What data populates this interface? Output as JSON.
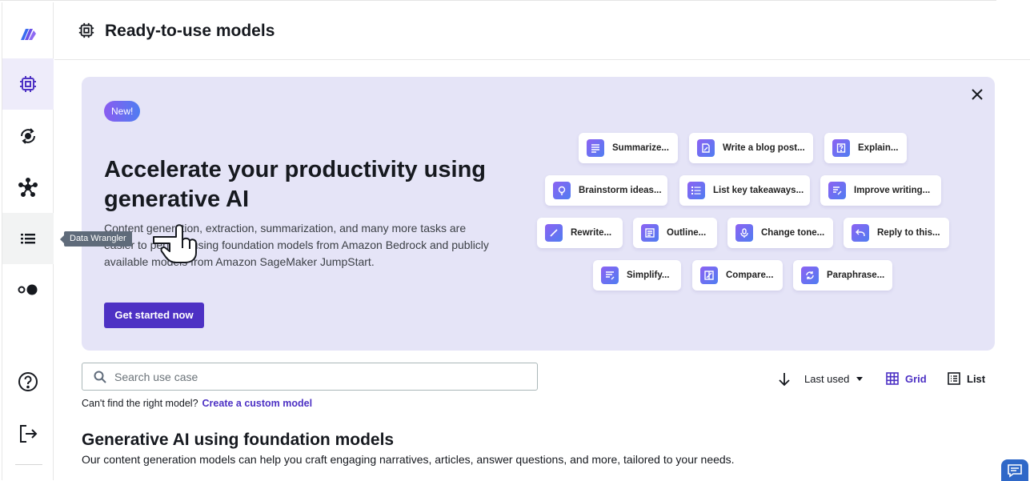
{
  "header": {
    "title": "Ready-to-use models"
  },
  "sidebar": {
    "tooltip": "Data Wrangler",
    "items": [
      {
        "name": "logo",
        "icon": "canvas-logo-icon"
      },
      {
        "name": "ready-to-use-models",
        "icon": "chip-icon",
        "active": true
      },
      {
        "name": "my-models",
        "icon": "model-cycle-icon"
      },
      {
        "name": "ml-ops",
        "icon": "network-nodes-icon"
      },
      {
        "name": "data-wrangler",
        "icon": "list-icon",
        "hovered": true
      },
      {
        "name": "toggle",
        "icon": "toggle-icon"
      },
      {
        "name": "help",
        "icon": "help-icon"
      },
      {
        "name": "sign-out",
        "icon": "sign-out-icon"
      }
    ]
  },
  "banner": {
    "badge": "New!",
    "title": "Accelerate your productivity using generative AI",
    "description": "Content generation, extraction, summarization, and many more tasks are easier to perform using foundation models from Amazon Bedrock and publicly available models from Amazon SageMaker JumpStart.",
    "cta": "Get started now",
    "chips": [
      {
        "label": "Summarize...",
        "icon": "lines-icon"
      },
      {
        "label": "Write a blog post...",
        "icon": "doc-edit-icon"
      },
      {
        "label": "Explain...",
        "icon": "question-doc-icon"
      },
      {
        "label": "Brainstorm ideas...",
        "icon": "lightbulb-icon"
      },
      {
        "label": "List key takeaways...",
        "icon": "bullet-list-icon"
      },
      {
        "label": "Improve writing...",
        "icon": "pen-lines-icon"
      },
      {
        "label": "Rewrite...",
        "icon": "pencil-icon"
      },
      {
        "label": "Outline...",
        "icon": "outline-icon"
      },
      {
        "label": "Change tone...",
        "icon": "microphone-icon"
      },
      {
        "label": "Reply to this...",
        "icon": "reply-icon"
      },
      {
        "label": "Simplify...",
        "icon": "simplify-icon"
      },
      {
        "label": "Compare...",
        "icon": "compare-icon"
      },
      {
        "label": "Paraphrase...",
        "icon": "refresh-icon"
      }
    ]
  },
  "search": {
    "placeholder": "Search use case",
    "value": ""
  },
  "sort": {
    "label": "Last used"
  },
  "views": {
    "grid": "Grid",
    "list": "List",
    "selected": "Grid"
  },
  "hint": {
    "text": "Can't find the right model?",
    "link": "Create a custom model"
  },
  "section": {
    "title": "Generative AI using foundation models",
    "description": "Our content generation models can help you craft engaging narratives, articles, answer questions, and more, tailored to your needs."
  },
  "colors": {
    "accent": "#4d31c4",
    "banner": "#e5e4f7",
    "tooltip": "#5f6b7a"
  }
}
